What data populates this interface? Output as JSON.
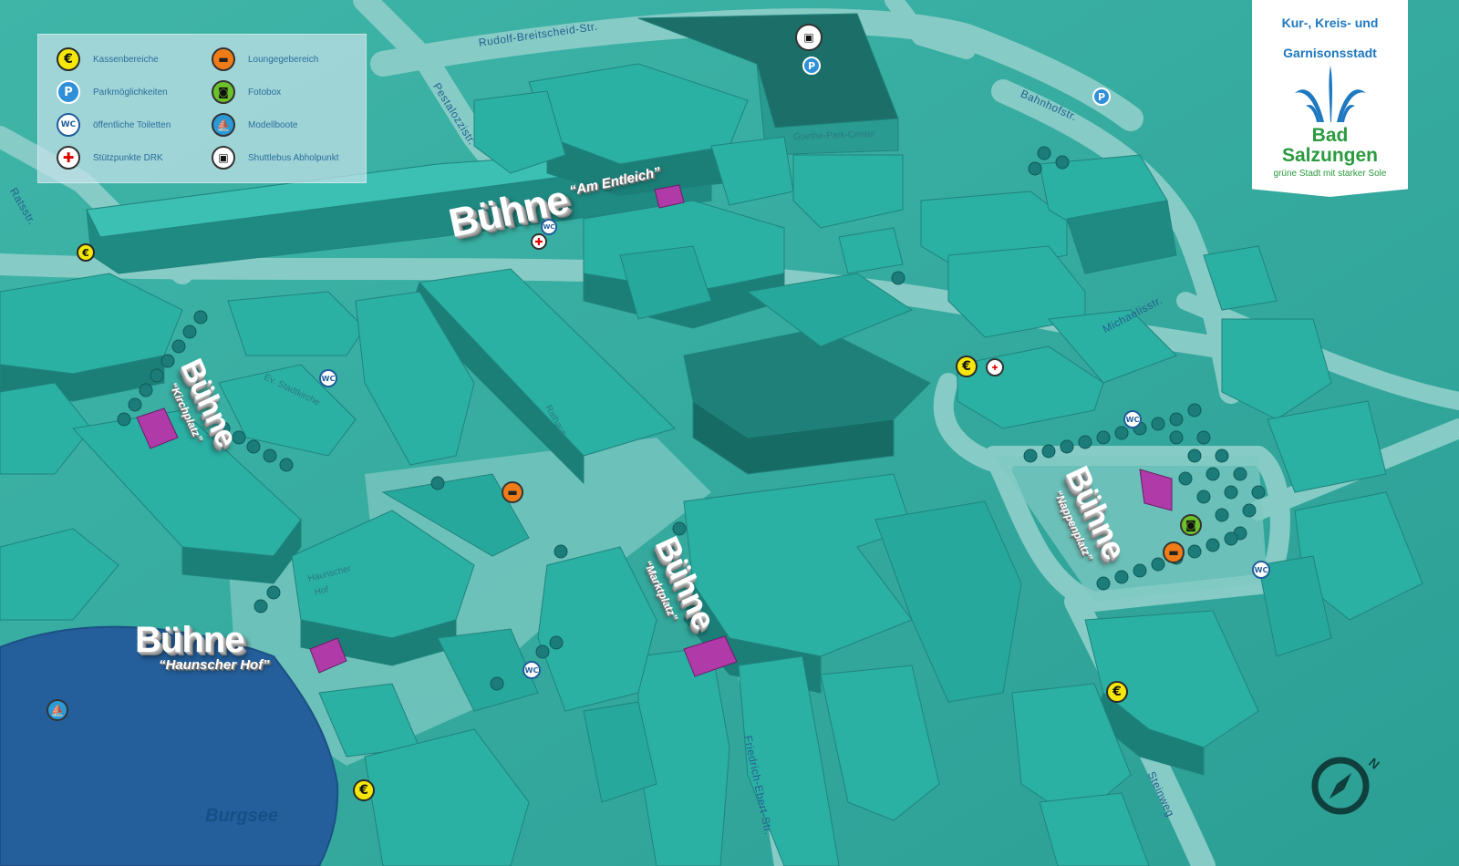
{
  "legend": {
    "items": [
      {
        "icon": "euro-icon",
        "glyph": "€",
        "label": "Kassenbereiche"
      },
      {
        "icon": "parking-icon",
        "glyph": "P",
        "label": "Parkmöglichkeiten"
      },
      {
        "icon": "wc-icon",
        "glyph": "WC",
        "label": "öffentliche Toiletten"
      },
      {
        "icon": "red-cross-icon",
        "glyph": "✚",
        "label": "Stützpunkte DRK"
      },
      {
        "icon": "sofa-icon",
        "glyph": "▬",
        "label": "Loungegebereich"
      },
      {
        "icon": "camera-icon",
        "glyph": "◙",
        "label": "Fotobox"
      },
      {
        "icon": "sailboat-icon",
        "glyph": "⛵",
        "label": "Modellboote"
      },
      {
        "icon": "bus-icon",
        "glyph": "▣",
        "label": "Shuttlebus Abholpunkt"
      }
    ]
  },
  "logo": {
    "line1": "Kur-, Kreis- und",
    "line2": "Garnisonsstadt",
    "name1": "Bad",
    "name2": "Salzungen",
    "tagline": "grüne Stadt mit starker Sole"
  },
  "stages": [
    {
      "word": "Bühne",
      "sub": "“Am Entleich”"
    },
    {
      "word": "Bühne",
      "sub": "“Kirchplatz”"
    },
    {
      "word": "Bühne",
      "sub": "“Marktplatz”"
    },
    {
      "word": "Bühne",
      "sub": "“Nappenplatz”"
    },
    {
      "word": "Bühne",
      "sub": "“Haunscher Hof”"
    }
  ],
  "streets": {
    "rudolf": "Rudolf-Breitscheid-Str.",
    "pestalozzi": "Pestalozzistr.",
    "bahnhof": "Bahnhofstr.",
    "rats": "Ratsstr.",
    "michaelis": "Michaelisstr.",
    "friedrich": "Friedrich-Ebert-Str.",
    "steinweg": "Steinweg"
  },
  "places": {
    "goethe": "Goethe-Park-Center",
    "rathaus": "Rathaus",
    "stadtkirche": "Ev. Stadtkirche",
    "haunscher1": "Haunscher",
    "haunscher2": "Hof"
  },
  "lake": "Burgsee",
  "compass_letter": "N",
  "icon_glyphs": {
    "euro": "€",
    "parking": "P",
    "wc": "WC",
    "drk": "✚",
    "lounge": "▬",
    "photo": "◙",
    "boat": "⛵",
    "bus": "▣"
  },
  "colors": {
    "ground": "#36ab9f",
    "street": "#8fd1cb",
    "building_top": "#2fb2a6",
    "building_side": "#1c7f78",
    "lake": "#245f9b",
    "stage_marker": "#b03aa8"
  }
}
